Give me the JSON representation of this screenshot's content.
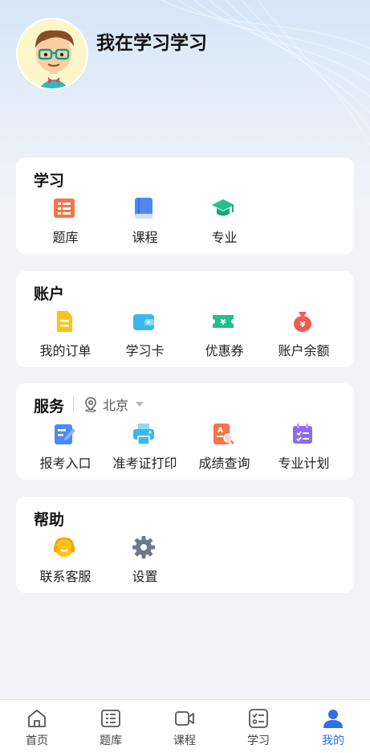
{
  "profile": {
    "username": "我在学习学习"
  },
  "sections": {
    "study": {
      "title": "学习",
      "items": [
        {
          "label": "题库",
          "icon": "question-bank-icon"
        },
        {
          "label": "课程",
          "icon": "course-book-icon"
        },
        {
          "label": "专业",
          "icon": "graduation-cap-icon"
        }
      ]
    },
    "account": {
      "title": "账户",
      "items": [
        {
          "label": "我的订单",
          "icon": "order-document-icon"
        },
        {
          "label": "学习卡",
          "icon": "study-card-wallet-icon"
        },
        {
          "label": "优惠券",
          "icon": "coupon-icon"
        },
        {
          "label": "账户余额",
          "icon": "money-bag-icon"
        }
      ]
    },
    "service": {
      "title": "服务",
      "location": "北京",
      "items": [
        {
          "label": "报考入口",
          "icon": "registration-icon"
        },
        {
          "label": "准考证打印",
          "icon": "printer-icon"
        },
        {
          "label": "成绩查询",
          "icon": "score-query-icon"
        },
        {
          "label": "专业计划",
          "icon": "plan-calendar-icon"
        }
      ]
    },
    "help": {
      "title": "帮助",
      "items": [
        {
          "label": "联系客服",
          "icon": "customer-service-icon"
        },
        {
          "label": "设置",
          "icon": "settings-gear-icon"
        }
      ]
    }
  },
  "tabbar": [
    {
      "label": "首页",
      "icon": "home-icon"
    },
    {
      "label": "题库",
      "icon": "question-bank-tab-icon"
    },
    {
      "label": "课程",
      "icon": "video-course-icon"
    },
    {
      "label": "学习",
      "icon": "checklist-icon"
    },
    {
      "label": "我的",
      "icon": "profile-icon",
      "active": true
    }
  ],
  "colors": {
    "accent": "#2f6fe8",
    "orange": "#f5744a",
    "blue": "#4b8af5",
    "green": "#22c08a",
    "yellow": "#ffc21a",
    "cyan": "#3bb7f0",
    "red": "#f25b4f",
    "purple": "#8a6bf0"
  }
}
